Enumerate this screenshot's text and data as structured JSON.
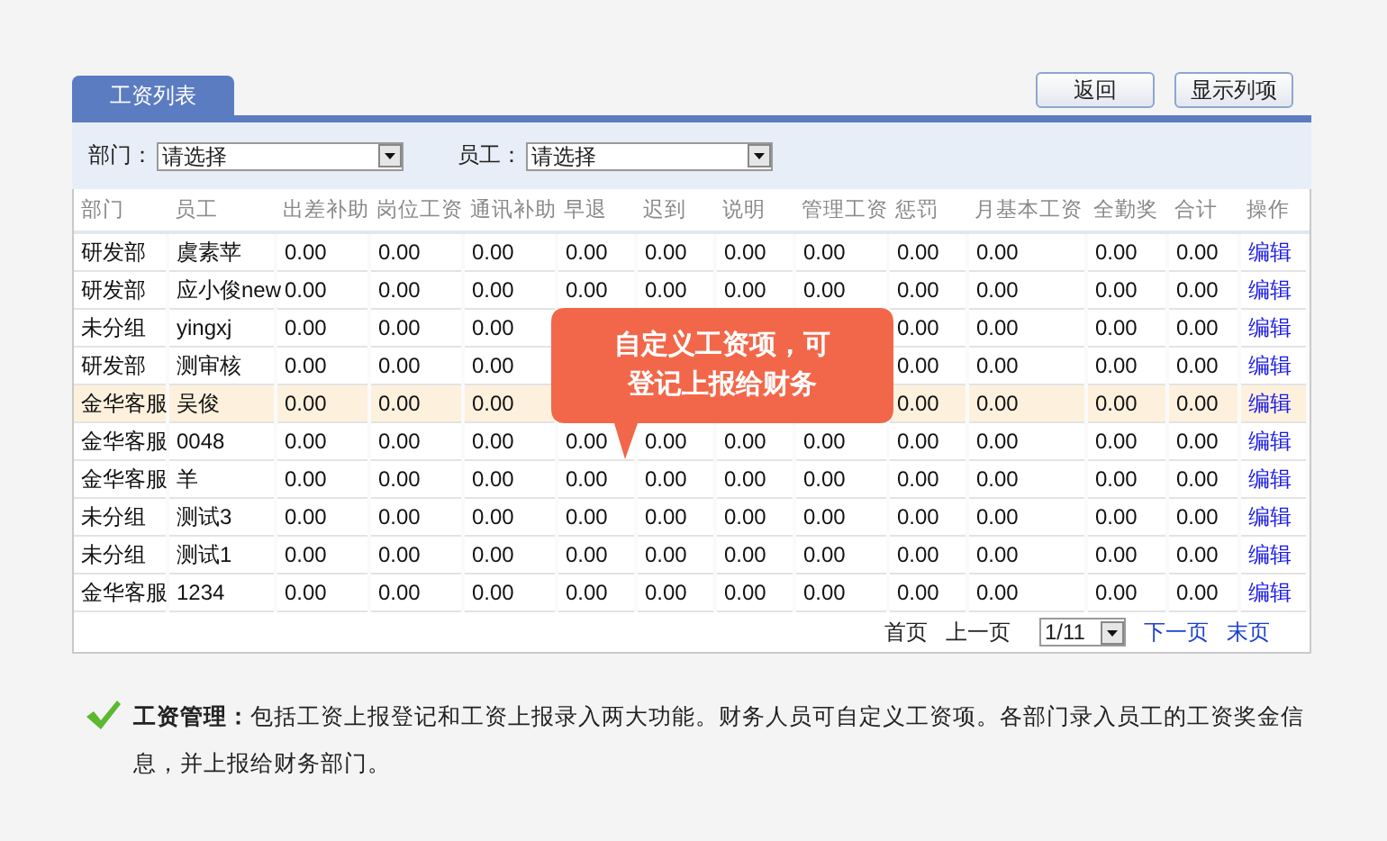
{
  "tabs": [
    {
      "label": "工资列表",
      "selected": true
    }
  ],
  "buttons": [
    "返回",
    "显示列项"
  ],
  "filters": [
    {
      "label": "部门：",
      "value": "请选择"
    },
    {
      "label": "员工：",
      "value": "请选择"
    }
  ],
  "table": {
    "columns": [
      "部门",
      "员工",
      "出差补助",
      "岗位工资",
      "通讯补助",
      "早退",
      "迟到",
      "说明",
      "管理工资",
      "惩罚",
      "月基本工资",
      "全勤奖",
      "合计",
      "操作"
    ],
    "rows": [
      {
        "selected": false,
        "cells": [
          "研发部",
          "虞素苹",
          "0.00",
          "0.00",
          "0.00",
          "0.00",
          "0.00",
          "0.00",
          "0.00",
          "0.00",
          "0.00",
          "0.00",
          "0.00"
        ],
        "action": "编辑"
      },
      {
        "selected": false,
        "cells": [
          "研发部",
          "应小俊new",
          "0.00",
          "0.00",
          "0.00",
          "0.00",
          "0.00",
          "0.00",
          "0.00",
          "0.00",
          "0.00",
          "0.00",
          "0.00"
        ],
        "action": "编辑"
      },
      {
        "selected": false,
        "cells": [
          "未分组",
          "yingxj",
          "0.00",
          "0.00",
          "0.00",
          null,
          null,
          null,
          null,
          "0.00",
          "0.00",
          "0.00",
          "0.00"
        ],
        "action": "编辑"
      },
      {
        "selected": false,
        "cells": [
          "研发部",
          "测审核",
          "0.00",
          "0.00",
          "0.00",
          null,
          null,
          null,
          null,
          "0.00",
          "0.00",
          "0.00",
          "0.00"
        ],
        "action": "编辑"
      },
      {
        "selected": true,
        "cells": [
          "金华客服",
          "吴俊",
          "0.00",
          "0.00",
          "0.00",
          null,
          null,
          null,
          null,
          "0.00",
          "0.00",
          "0.00",
          "0.00"
        ],
        "action": "编辑"
      },
      {
        "selected": false,
        "cells": [
          "金华客服",
          "0048",
          "0.00",
          "0.00",
          "0.00",
          "0.00",
          "0.00",
          "0.00",
          "0.00",
          "0.00",
          "0.00",
          "0.00",
          "0.00"
        ],
        "action": "编辑"
      },
      {
        "selected": false,
        "cells": [
          "金华客服",
          "羊",
          "0.00",
          "0.00",
          "0.00",
          "0.00",
          "0.00",
          "0.00",
          "0.00",
          "0.00",
          "0.00",
          "0.00",
          "0.00"
        ],
        "action": "编辑"
      },
      {
        "selected": false,
        "cells": [
          "未分组",
          "测试3",
          "0.00",
          "0.00",
          "0.00",
          "0.00",
          "0.00",
          "0.00",
          "0.00",
          "0.00",
          "0.00",
          "0.00",
          "0.00"
        ],
        "action": "编辑"
      },
      {
        "selected": false,
        "cells": [
          "未分组",
          "测试1",
          "0.00",
          "0.00",
          "0.00",
          "0.00",
          "0.00",
          "0.00",
          "0.00",
          "0.00",
          "0.00",
          "0.00",
          "0.00"
        ],
        "action": "编辑"
      },
      {
        "selected": false,
        "cells": [
          "金华客服",
          "1234",
          "0.00",
          "0.00",
          "0.00",
          "0.00",
          "0.00",
          "0.00",
          "0.00",
          "0.00",
          "0.00",
          "0.00",
          "0.00"
        ],
        "action": "编辑"
      }
    ]
  },
  "callout": {
    "text": "自定义工资项，可登记上报给财务"
  },
  "pagination": [
    {
      "kind": "link",
      "label": "首页",
      "disabled": true
    },
    {
      "kind": "link",
      "label": "上一页",
      "disabled": true
    },
    {
      "kind": "select",
      "label": "1/11"
    },
    {
      "kind": "link",
      "label": "下一页",
      "disabled": false
    },
    {
      "kind": "link",
      "label": "末页",
      "disabled": false
    }
  ],
  "note": {
    "text": "**工资管理：**包括工资上报登记和工资上报录入两大功能。财务人员可自定义工资项。各部门录入员工的工资奖金信息，并上报给财务部门。"
  }
}
